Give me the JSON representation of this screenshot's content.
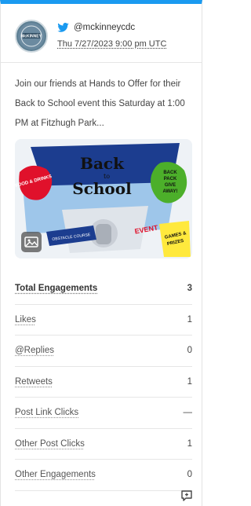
{
  "header": {
    "network_icon": "twitter-bird-icon",
    "handle": "@mckinneycdc",
    "date": "Thu 7/27/2023 9:00 pm UTC",
    "avatar_text": "McKINNEY"
  },
  "post": {
    "text": "Join our friends at Hands to Offer for their Back to School event this Saturday at 1:00 PM at Fitzhugh Park...",
    "image": {
      "title_line1": "Back",
      "title_line2": "to",
      "title_line3": "School",
      "left_splat": "FOOD & DRINKS",
      "right_badge_line1": "BACK",
      "right_badge_line2": "PACK",
      "right_badge_line3": "GIVE",
      "right_badge_line4": "AWAY!",
      "event_text": "EVENT",
      "bottom_right_line1": "GAMES &",
      "bottom_right_line2": "PRIZES",
      "bottom_left_text": "OBSTACLE COURSE",
      "badge_icon": "image-icon"
    }
  },
  "metrics": [
    {
      "label": "Total Engagements",
      "value": "3"
    },
    {
      "label": "Likes",
      "value": "1"
    },
    {
      "label": "@Replies",
      "value": "0"
    },
    {
      "label": "Retweets",
      "value": "1"
    },
    {
      "label": "Post Link Clicks",
      "value": "—"
    },
    {
      "label": "Other Post Clicks",
      "value": "1"
    },
    {
      "label": "Other Engagements",
      "value": "0"
    }
  ],
  "footer": {
    "icon": "comment-reply-icon"
  },
  "colors": {
    "accent": "#1a9af0"
  }
}
